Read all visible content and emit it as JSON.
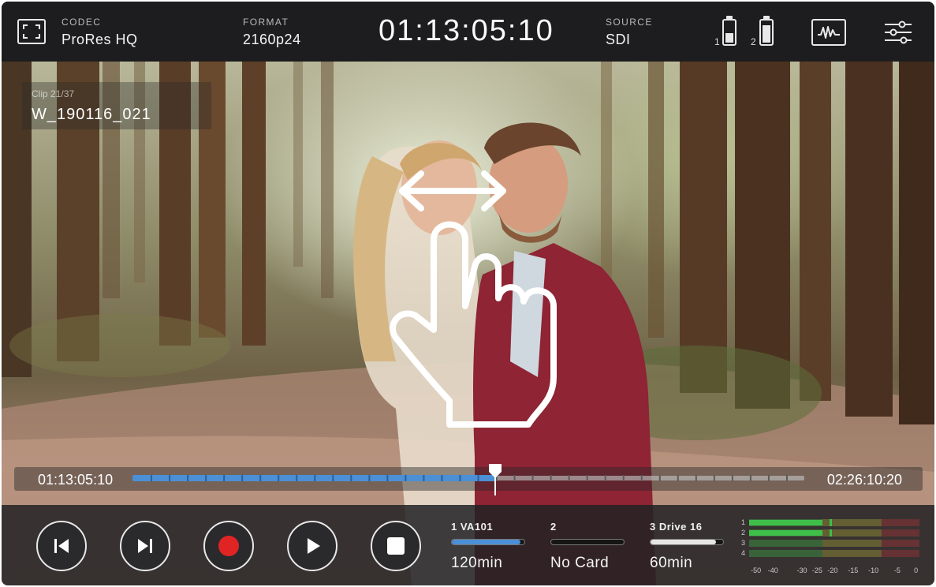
{
  "topbar": {
    "codec_label": "CODEC",
    "codec_value": "ProRes HQ",
    "format_label": "FORMAT",
    "format_value": "2160p24",
    "timecode": "01:13:05:10",
    "source_label": "SOURCE",
    "source_value": "SDI",
    "battery_1_num": "1",
    "battery_2_num": "2",
    "battery_1_level": 0.45,
    "battery_2_level": 0.85,
    "icons": [
      "fullscreen-icon",
      "battery-icon",
      "battery-icon",
      "scope-icon",
      "settings-icon"
    ]
  },
  "clip": {
    "number": "Clip 21/37",
    "name": "W_190116_021"
  },
  "timeline": {
    "start": "01:13:05:10",
    "end": "02:26:10:20",
    "progress": 0.54
  },
  "transport": {
    "buttons": [
      "skip-back",
      "skip-forward",
      "record",
      "play",
      "stop"
    ],
    "record_color": "#e02424"
  },
  "media": [
    {
      "label": "1  VA101",
      "value": "120min",
      "fill": 0.95,
      "color": "#4b8fd6"
    },
    {
      "label": "2",
      "value": "No Card",
      "fill": 0,
      "color": "#555555"
    },
    {
      "label": "3  Drive 16",
      "value": "60min",
      "fill": 0.9,
      "color": "#e6e6e6"
    }
  ],
  "audio_meters": {
    "channels": [
      "1",
      "2",
      "3",
      "4"
    ],
    "levels": [
      0.43,
      0.43,
      0,
      0
    ],
    "peaks": [
      0.47,
      0.47,
      0,
      0
    ],
    "scale": [
      "-50",
      "-40",
      "-30",
      "-25",
      "-20",
      "-15",
      "-10",
      "-5",
      "0"
    ],
    "colors": {
      "green": "#3fbf4a",
      "yellow": "#b9b23a",
      "red": "#c0353a"
    }
  },
  "colors": {
    "accent": "#4b8fd6",
    "topbar_bg": "#1d1d1f"
  }
}
